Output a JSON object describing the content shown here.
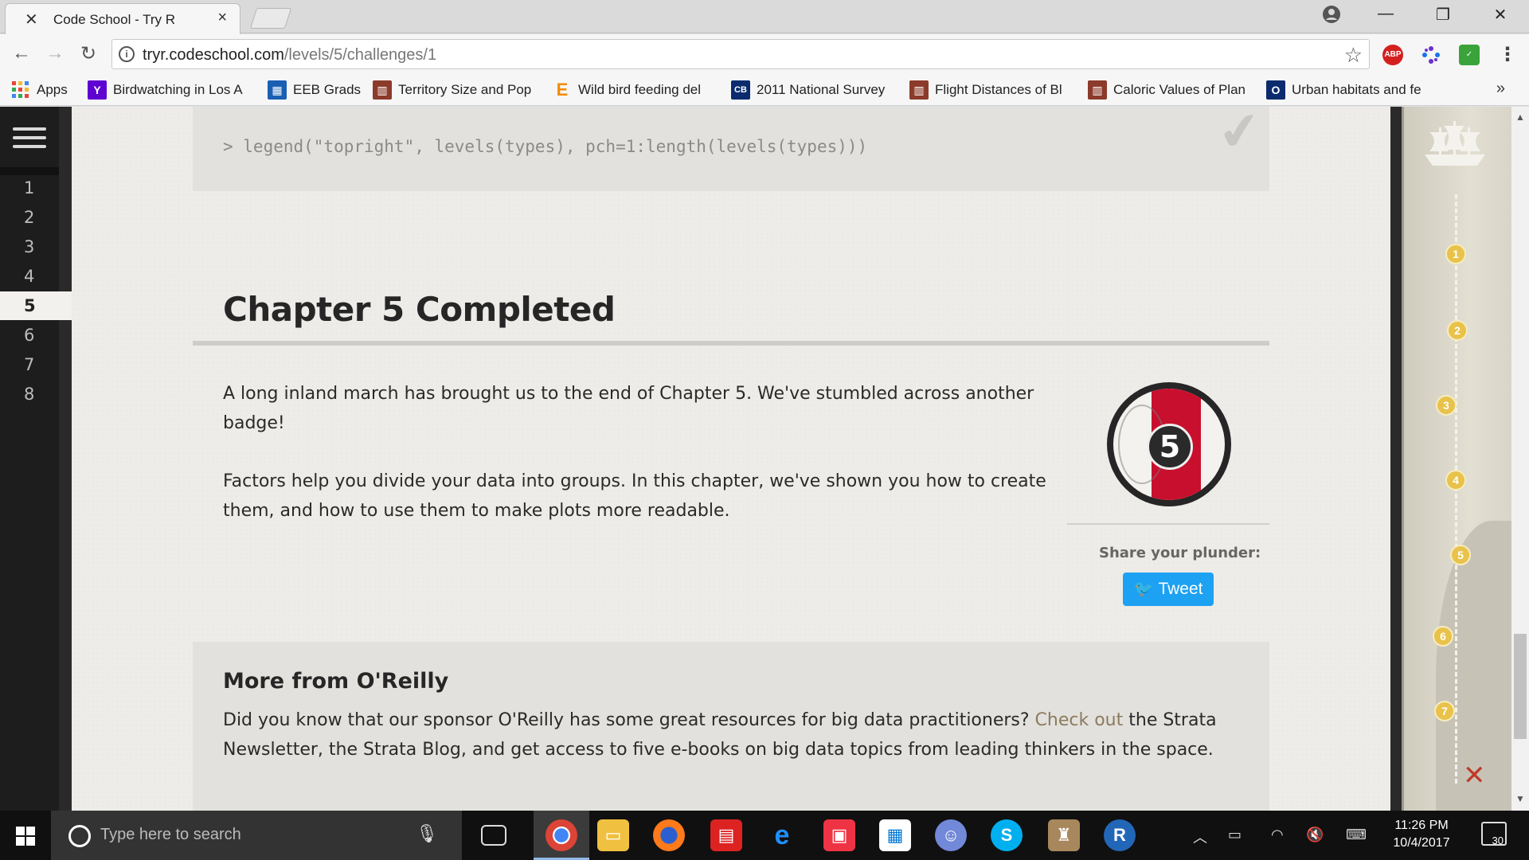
{
  "browser": {
    "tab_title": "Code School - Try R",
    "tab_close": "×",
    "url_host": "tryr.codeschool.com",
    "url_path": "/levels/5/challenges/1",
    "ext_abp": "ABP",
    "bookmarks_more": "»",
    "bookmarks": [
      {
        "label": "Apps",
        "icon": "apps-grid-icon",
        "color": "#e8453c"
      },
      {
        "label": "Birdwatching in Los A",
        "icon": "yahoo-icon",
        "color": "#5f01d1"
      },
      {
        "label": "EEB Grads",
        "icon": "calendar-icon",
        "color": "#1a5fb4"
      },
      {
        "label": "Territory Size and Pop",
        "icon": "journal-icon",
        "color": "#8c3b2b"
      },
      {
        "label": "Wild bird feeding del",
        "icon": "elsevier-icon",
        "color": "#f28b00"
      },
      {
        "label": "2011 National Survey",
        "icon": "census-icon",
        "color": "#0b2b6e"
      },
      {
        "label": "Flight Distances of Bl",
        "icon": "journal-icon",
        "color": "#8c3b2b"
      },
      {
        "label": "Caloric Values of Plan",
        "icon": "journal-icon",
        "color": "#8c3b2b"
      },
      {
        "label": "Urban habitats and fe",
        "icon": "oxford-icon",
        "color": "#0b2b6e"
      }
    ],
    "apps_letter": "",
    "yahoo_letter": "Y",
    "elsevier_letter": "E",
    "census_letter": "CB",
    "oxford_letter": "O"
  },
  "sidebar": {
    "levels": [
      "1",
      "2",
      "3",
      "4",
      "5",
      "6",
      "7",
      "8"
    ],
    "active_level": "5"
  },
  "lesson": {
    "code_line": "> legend(\"topright\", levels(types), pch=1:length(levels(types)))",
    "chapter_title": "Chapter 5 Completed",
    "paragraph1": "A long inland march has brought us to the end of Chapter 5. We've stumbled across another badge!",
    "paragraph2": "Factors help you divide your data into groups. In this chapter, we've shown you how to create them, and how to use them to make plots more readable.",
    "badge_number": "5",
    "share_label": "Share your plunder:",
    "tweet_label": "Tweet",
    "oreilly_heading": "More from O'Reilly",
    "oreilly_text_before": "Did you know that our sponsor O'Reilly has some great resources for big data practitioners? ",
    "oreilly_link": "Check out",
    "oreilly_text_after": " the Strata Newsletter, the Strata Blog, and get access to five e-books on big data topics from leading thinkers in the space."
  },
  "map": {
    "waypoints": [
      "1",
      "2",
      "3",
      "4",
      "5",
      "6",
      "7"
    ],
    "end_marker": "✕"
  },
  "taskbar": {
    "search_placeholder": "Type here to search",
    "time": "11:26 PM",
    "date": "10/4/2017",
    "notifications": "30"
  }
}
